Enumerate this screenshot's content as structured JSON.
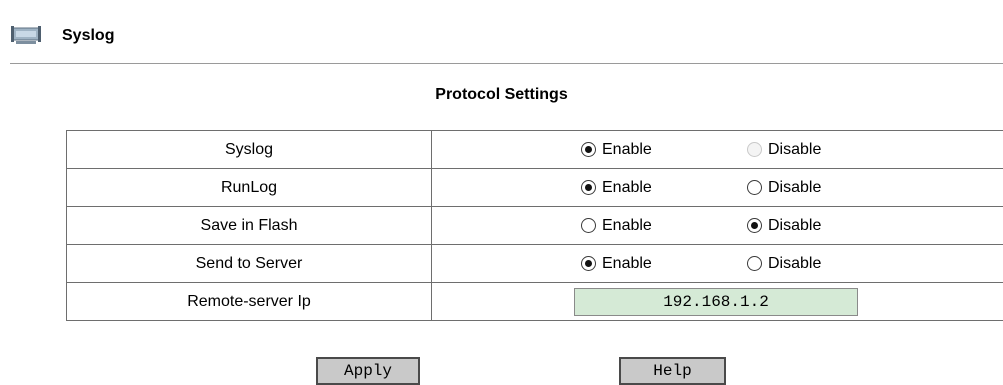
{
  "page": {
    "title": "Syslog",
    "icon": "router-icon"
  },
  "section": {
    "title": "Protocol Settings"
  },
  "settings": {
    "rows": [
      {
        "label": "Syslog",
        "option1": "Enable",
        "option2": "Disable",
        "selected": "Enable",
        "option2_disabled": true
      },
      {
        "label": "RunLog",
        "option1": "Enable",
        "option2": "Disable",
        "selected": "Enable"
      },
      {
        "label": "Save in Flash",
        "option1": "Enable",
        "option2": "Disable",
        "selected": "Disable"
      },
      {
        "label": "Send to Server",
        "option1": "Enable",
        "option2": "Disable",
        "selected": "Enable"
      }
    ],
    "remote_ip": {
      "label": "Remote-server Ip",
      "value": "192.168.1.2"
    }
  },
  "buttons": {
    "apply": "Apply",
    "help": "Help"
  },
  "colors": {
    "input_background": "#d5ead6",
    "button_background": "#c9c9c9"
  }
}
